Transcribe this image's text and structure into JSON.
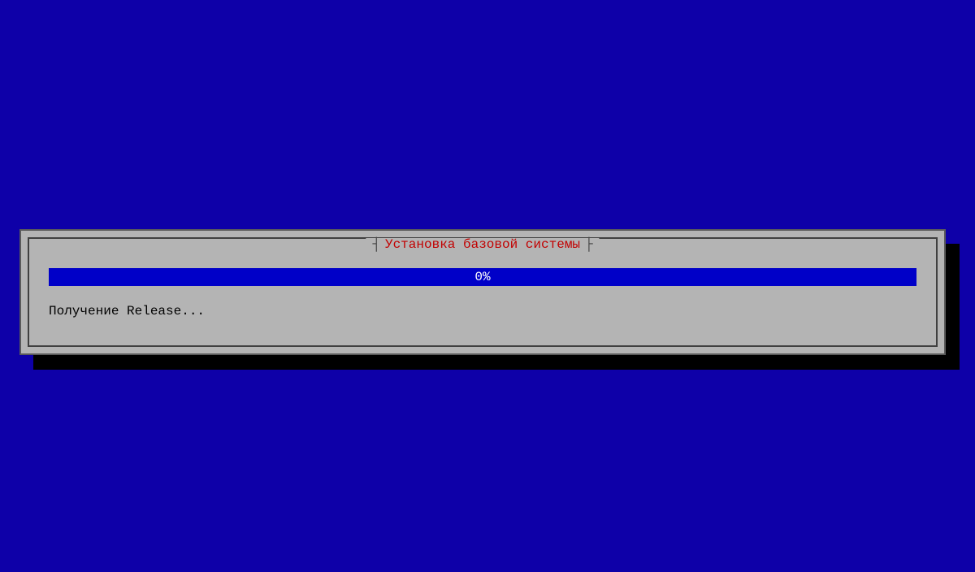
{
  "dialog": {
    "title": "Установка базовой системы",
    "progress_percent": "0%",
    "status": "Получение Release..."
  },
  "colors": {
    "background": "#0e00a8",
    "dialog_bg": "#b4b4b4",
    "title": "#c20000",
    "progress_fill": "#0000c8"
  }
}
